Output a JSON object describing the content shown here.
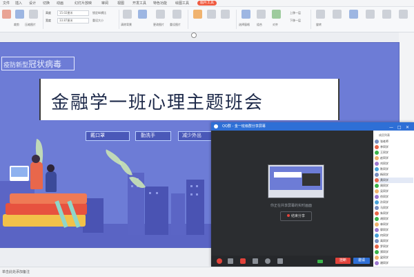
{
  "menu": {
    "items": [
      "文件",
      "插入",
      "设计",
      "切换",
      "动画",
      "幻灯片放映",
      "审阅",
      "视图",
      "开发工具",
      "特色功能",
      "绘图工具"
    ],
    "active": "图片工具"
  },
  "ribbon": {
    "height_label": "高度",
    "height_value": "15.02厘米",
    "width_label": "宽度",
    "width_value": "33.87厘米",
    "lock_ratio": "锁定纵横比",
    "reset_size": "重设大小",
    "crop": "裁剪",
    "compress": "压缩图片",
    "clear_bg": "清除背景",
    "change_pic": "更改图片",
    "reset_pic": "重设图片",
    "up_one": "上移一层",
    "down_one": "下移一层",
    "align": "对齐",
    "rotate": "旋转",
    "select_pane": "选择窗格",
    "group": "组合"
  },
  "slide": {
    "tag_text_small": "疫防新型",
    "tag_text_big": "冠状病毒",
    "title": "金融学一班心理主题班会",
    "slogans": [
      "勤洗手",
      "戴口罩",
      "常通风",
      "减少外出"
    ]
  },
  "qq_window": {
    "title": "QQ群",
    "subtitle": "金一班级群分享屏幕",
    "caption": "你正在共享屏幕的实时画面",
    "stop_label": "结束分享",
    "bottom_btn_red": "挂断",
    "bottom_btn_blue": "邀请",
    "members_header": "成员列表",
    "members": [
      "张老师",
      "李同学",
      "王同学",
      "赵同学",
      "刘同学",
      "陈同学",
      "杨同学",
      "黄同学",
      "周同学",
      "吴同学",
      "徐同学",
      "孙同学",
      "马同学",
      "朱同学",
      "胡同学",
      "林同学",
      "郭同学",
      "何同学",
      "高同学",
      "罗同学",
      "郑同学",
      "梁同学",
      "谢同学"
    ]
  },
  "status": {
    "text": "单击此处添加备注"
  },
  "colors": {
    "slide_bg": "#6d7cd6",
    "accent": "#f05b41",
    "qq_blue": "#2e6fd6"
  }
}
